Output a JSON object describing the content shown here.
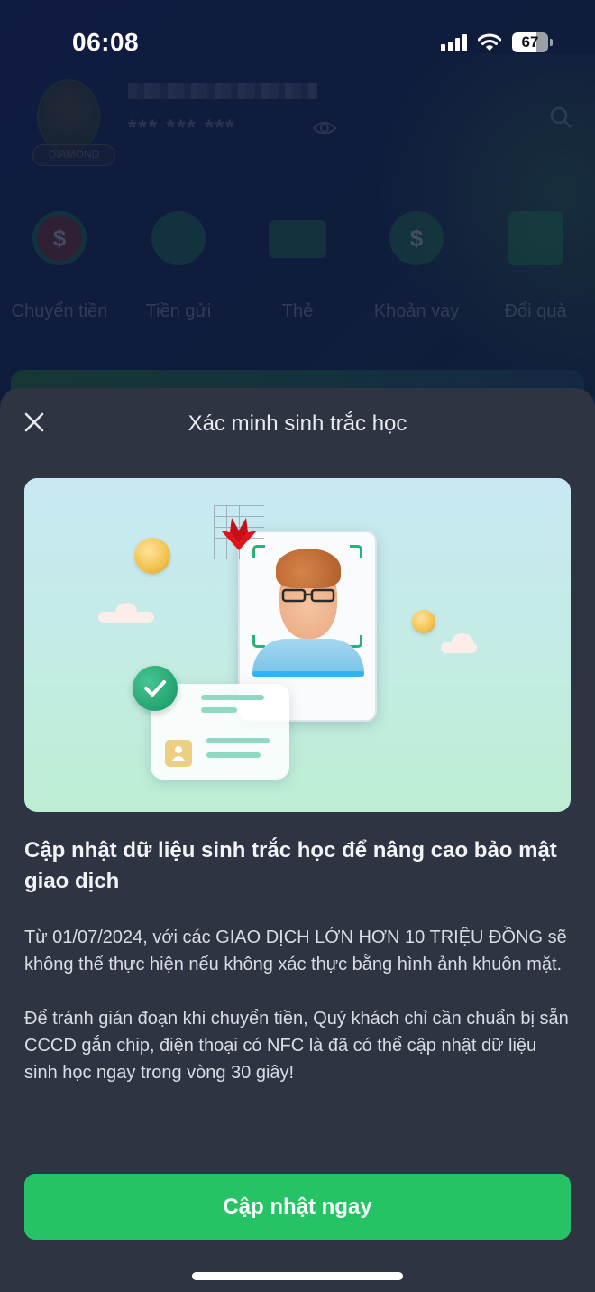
{
  "status_bar": {
    "time": "06:08",
    "battery_level": "67",
    "battery_fraction": 0.67,
    "icons": [
      "signal-icon",
      "wifi-icon",
      "battery-icon"
    ]
  },
  "background_app": {
    "tier_badge": "DIAMOND",
    "account_masked": "*** *** ***",
    "quick_actions": [
      {
        "label": "Chuyển tiền",
        "icon": "money-transfer-icon",
        "color": "#a5342d"
      },
      {
        "label": "Tiền gửi",
        "icon": "piggy-bank-icon",
        "color": "#1c8a5c"
      },
      {
        "label": "Thẻ",
        "icon": "card-icon",
        "color": "#1c8a5c"
      },
      {
        "label": "Khoản vay",
        "icon": "money-bag-icon",
        "color": "#1c8a5c"
      },
      {
        "label": "Đổi quà",
        "icon": "gift-icon",
        "color": "#1c8a5c"
      }
    ]
  },
  "sheet": {
    "title": "Xác minh sinh trắc học",
    "headline": "Cập nhật dữ liệu sinh trắc học để nâng cao bảo mật giao dịch",
    "paragraphs": [
      "Từ  01/07/2024, với các GIAO DỊCH LỚN HƠN 10 TRIỆU ĐỒNG sẽ không thể thực hiện nếu không xác thực bằng hình ảnh khuôn mặt.",
      "Để tránh gián đoạn khi chuyển tiền, Quý khách chỉ cần chuẩn bị sẵn CCCD gắn chip, điện thoại có NFC là đã có thể cập nhật dữ liệu sinh học ngay trong vòng 30 giây!"
    ],
    "primary_button": "Cập nhật ngay"
  },
  "colors": {
    "sheet_bg": "#2f3442",
    "primary": "#26c266",
    "brand_red": "#e0121b"
  }
}
